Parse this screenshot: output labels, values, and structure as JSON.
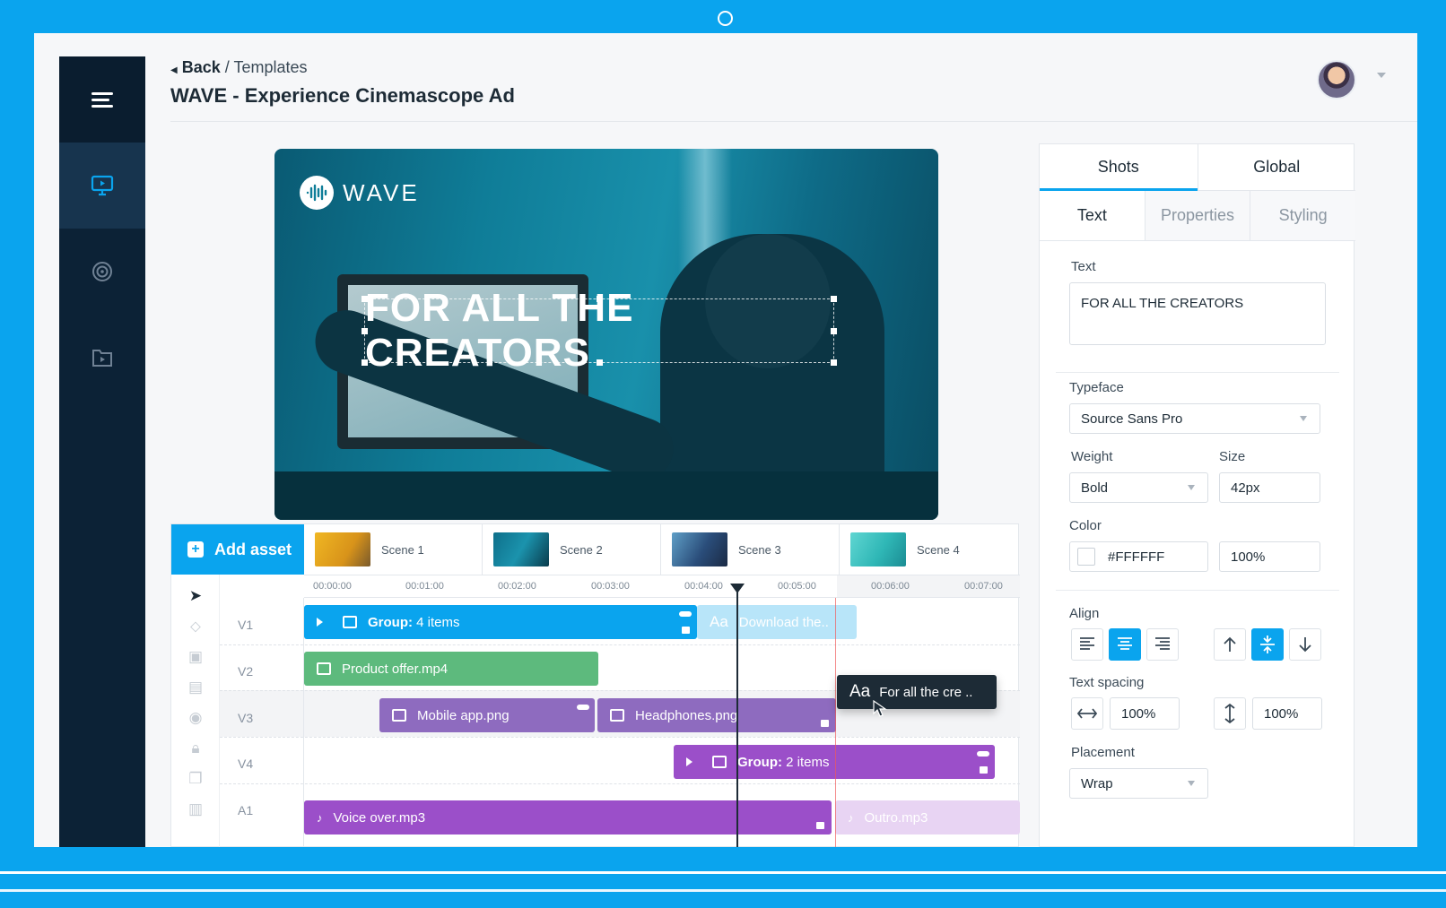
{
  "header": {
    "back_label": "Back",
    "separator": "/",
    "section": "Templates",
    "title": "WAVE - Experience Cinemascope Ad"
  },
  "preview": {
    "brand": "WAVE",
    "headline": "FOR ALL THE CREATORS"
  },
  "timeline": {
    "add_asset_label": "Add asset",
    "scenes": [
      "Scene 1",
      "Scene 2",
      "Scene 3",
      "Scene 4"
    ],
    "ruler": [
      "00:00:00",
      "00:01:00",
      "00:02:00",
      "00:03:00",
      "00:04:00",
      "00:05:00",
      "00:06:00",
      "00:07:00"
    ],
    "tracks": [
      "V1",
      "V2",
      "V3",
      "V4",
      "A1"
    ],
    "clips": {
      "v1_group_label": "Group:",
      "v1_group_count": "4 items",
      "v1_text": "Download the..",
      "v2_video": "Product offer.mp4",
      "v3_image1": "Mobile app.png",
      "v3_image2": "Headphones.png",
      "v4_group_label": "Group:",
      "v4_group_count": "2 items",
      "a1_audio1": "Voice over.mp3",
      "a1_audio2": "Outro.mp3"
    },
    "tooltip": {
      "icon": "Aa",
      "text": "For all the cre .."
    }
  },
  "panel": {
    "tabs": [
      "Shots",
      "Global"
    ],
    "subtabs": [
      "Text",
      "Properties",
      "Styling"
    ],
    "text_label": "Text",
    "text_value": "FOR ALL THE CREATORS",
    "typeface_label": "Typeface",
    "typeface_value": "Source Sans Pro",
    "weight_label": "Weight",
    "weight_value": "Bold",
    "size_label": "Size",
    "size_value": "42px",
    "color_label": "Color",
    "color_value": "#FFFFFF",
    "opacity_value": "100%",
    "align_label": "Align",
    "spacing_label": "Text spacing",
    "spacing_h_value": "100%",
    "spacing_v_value": "100%",
    "placement_label": "Placement",
    "placement_value": "Wrap"
  },
  "colors": {
    "accent": "#0aa4ee",
    "sidebar": "#0c2236",
    "clip_blue": "#0aa4ee",
    "clip_green": "#5dba7d",
    "clip_purple": "#8e6bbf",
    "clip_violet": "#9b4fc9"
  }
}
